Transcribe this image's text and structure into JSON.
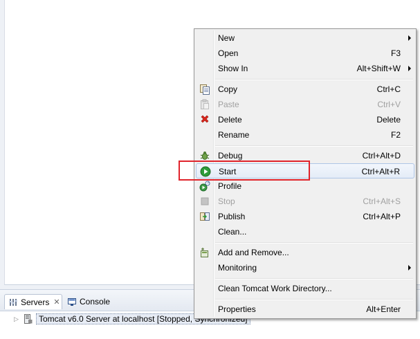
{
  "bottom_panel": {
    "tabs": [
      {
        "label": "Servers",
        "icon": "servers-icon",
        "active": true,
        "close_glyph": "✕"
      },
      {
        "label": "Console",
        "icon": "console-icon",
        "active": false
      }
    ],
    "server_row": {
      "twisty": "▷",
      "label": "Tomcat v6.0 Server at localhost  [Stopped, Synchronized]",
      "icon": "server-icon"
    }
  },
  "context_menu": {
    "items": [
      {
        "label": "New",
        "shortcut": "",
        "submenu": true,
        "icon": ""
      },
      {
        "label": "Open",
        "shortcut": "F3",
        "submenu": false,
        "icon": ""
      },
      {
        "label": "Show In",
        "shortcut": "Alt+Shift+W",
        "submenu": true,
        "icon": ""
      },
      {
        "label": "Copy",
        "shortcut": "Ctrl+C",
        "submenu": false,
        "icon": "copy-icon"
      },
      {
        "label": "Paste",
        "shortcut": "Ctrl+V",
        "submenu": false,
        "icon": "paste-icon",
        "disabled": true
      },
      {
        "label": "Delete",
        "shortcut": "Delete",
        "submenu": false,
        "icon": "delete-icon"
      },
      {
        "label": "Rename",
        "shortcut": "F2",
        "submenu": false,
        "icon": ""
      },
      {
        "label": "Debug",
        "shortcut": "Ctrl+Alt+D",
        "submenu": false,
        "icon": "debug-icon"
      },
      {
        "label": "Start",
        "shortcut": "Ctrl+Alt+R",
        "submenu": false,
        "icon": "start-icon",
        "highlighted": true
      },
      {
        "label": "Profile",
        "shortcut": "",
        "submenu": false,
        "icon": "profile-icon"
      },
      {
        "label": "Stop",
        "shortcut": "Ctrl+Alt+S",
        "submenu": false,
        "icon": "stop-icon",
        "disabled": true
      },
      {
        "label": "Publish",
        "shortcut": "Ctrl+Alt+P",
        "submenu": false,
        "icon": "publish-icon"
      },
      {
        "label": "Clean...",
        "shortcut": "",
        "submenu": false,
        "icon": ""
      },
      {
        "label": "Add and Remove...",
        "shortcut": "",
        "submenu": false,
        "icon": "add-remove-icon"
      },
      {
        "label": "Monitoring",
        "shortcut": "",
        "submenu": true,
        "icon": ""
      },
      {
        "label": "Clean Tomcat Work Directory...",
        "shortcut": "",
        "submenu": false,
        "icon": ""
      },
      {
        "label": "Properties",
        "shortcut": "Alt+Enter",
        "submenu": false,
        "icon": ""
      }
    ]
  },
  "colors": {
    "highlight_box": "#e0232b",
    "start_green": "#2e9b3a",
    "delete_red": "#d9261c"
  }
}
